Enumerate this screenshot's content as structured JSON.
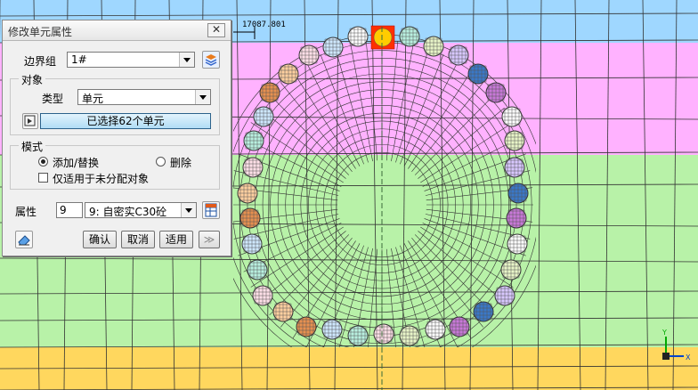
{
  "canvas": {
    "dimension_text": "17087.801",
    "colors": {
      "sky": "#9fd7ff",
      "upper_band": "#ffb2ff",
      "middle_band": "#b8f2a8",
      "bottom_band": "#ffd75e",
      "mesh_line": "#333333",
      "highlight": "#ff3000"
    }
  },
  "dialog": {
    "title": "修改单元属性",
    "close_label": "✕",
    "boundary_group_label": "边界组",
    "boundary_group_value": "1#",
    "object_group_label": "对象",
    "type_label": "类型",
    "type_value": "单元",
    "selection_button": "已选择62个单元",
    "mode_group_label": "模式",
    "mode_add_replace": "添加/替换",
    "mode_delete": "删除",
    "only_unassigned": "仅适用于未分配对象",
    "property_label": "属性",
    "property_number": "9",
    "property_value": "9: 自密实C30砼",
    "ok_button": "确认",
    "cancel_button": "取消",
    "apply_button": "适用",
    "more_button": "≫"
  }
}
